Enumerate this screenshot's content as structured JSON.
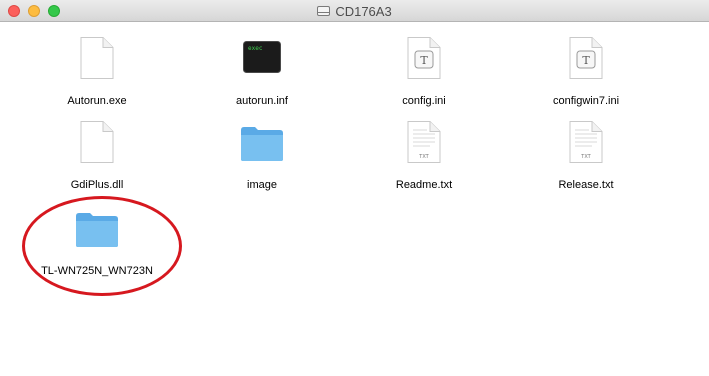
{
  "window": {
    "title": "CD176A3",
    "controls": [
      "close",
      "minimize",
      "maximize"
    ]
  },
  "files": [
    {
      "name": "Autorun.exe",
      "icon": "generic-document-icon"
    },
    {
      "name": "autorun.inf",
      "icon": "terminal-exec-icon",
      "icon_text": "exec"
    },
    {
      "name": "config.ini",
      "icon": "text-document-icon",
      "icon_text": "T"
    },
    {
      "name": "configwin7.ini",
      "icon": "text-document-icon",
      "icon_text": "T"
    },
    {
      "name": "GdiPlus.dll",
      "icon": "generic-document-icon"
    },
    {
      "name": "image",
      "icon": "folder-icon"
    },
    {
      "name": "Readme.txt",
      "icon": "txt-document-icon",
      "icon_text": "TXT"
    },
    {
      "name": "Release.txt",
      "icon": "txt-document-icon",
      "icon_text": "TXT"
    },
    {
      "name": "TL-WN725N_WN723N",
      "icon": "folder-icon"
    }
  ],
  "annotation": {
    "shape": "ellipse",
    "color": "#d6181f",
    "target": "TL-WN725N_WN723N"
  },
  "colors": {
    "folder": "#6fb7ec",
    "terminal_bg": "#1b1b1b",
    "terminal_text": "#3fcf4f"
  }
}
